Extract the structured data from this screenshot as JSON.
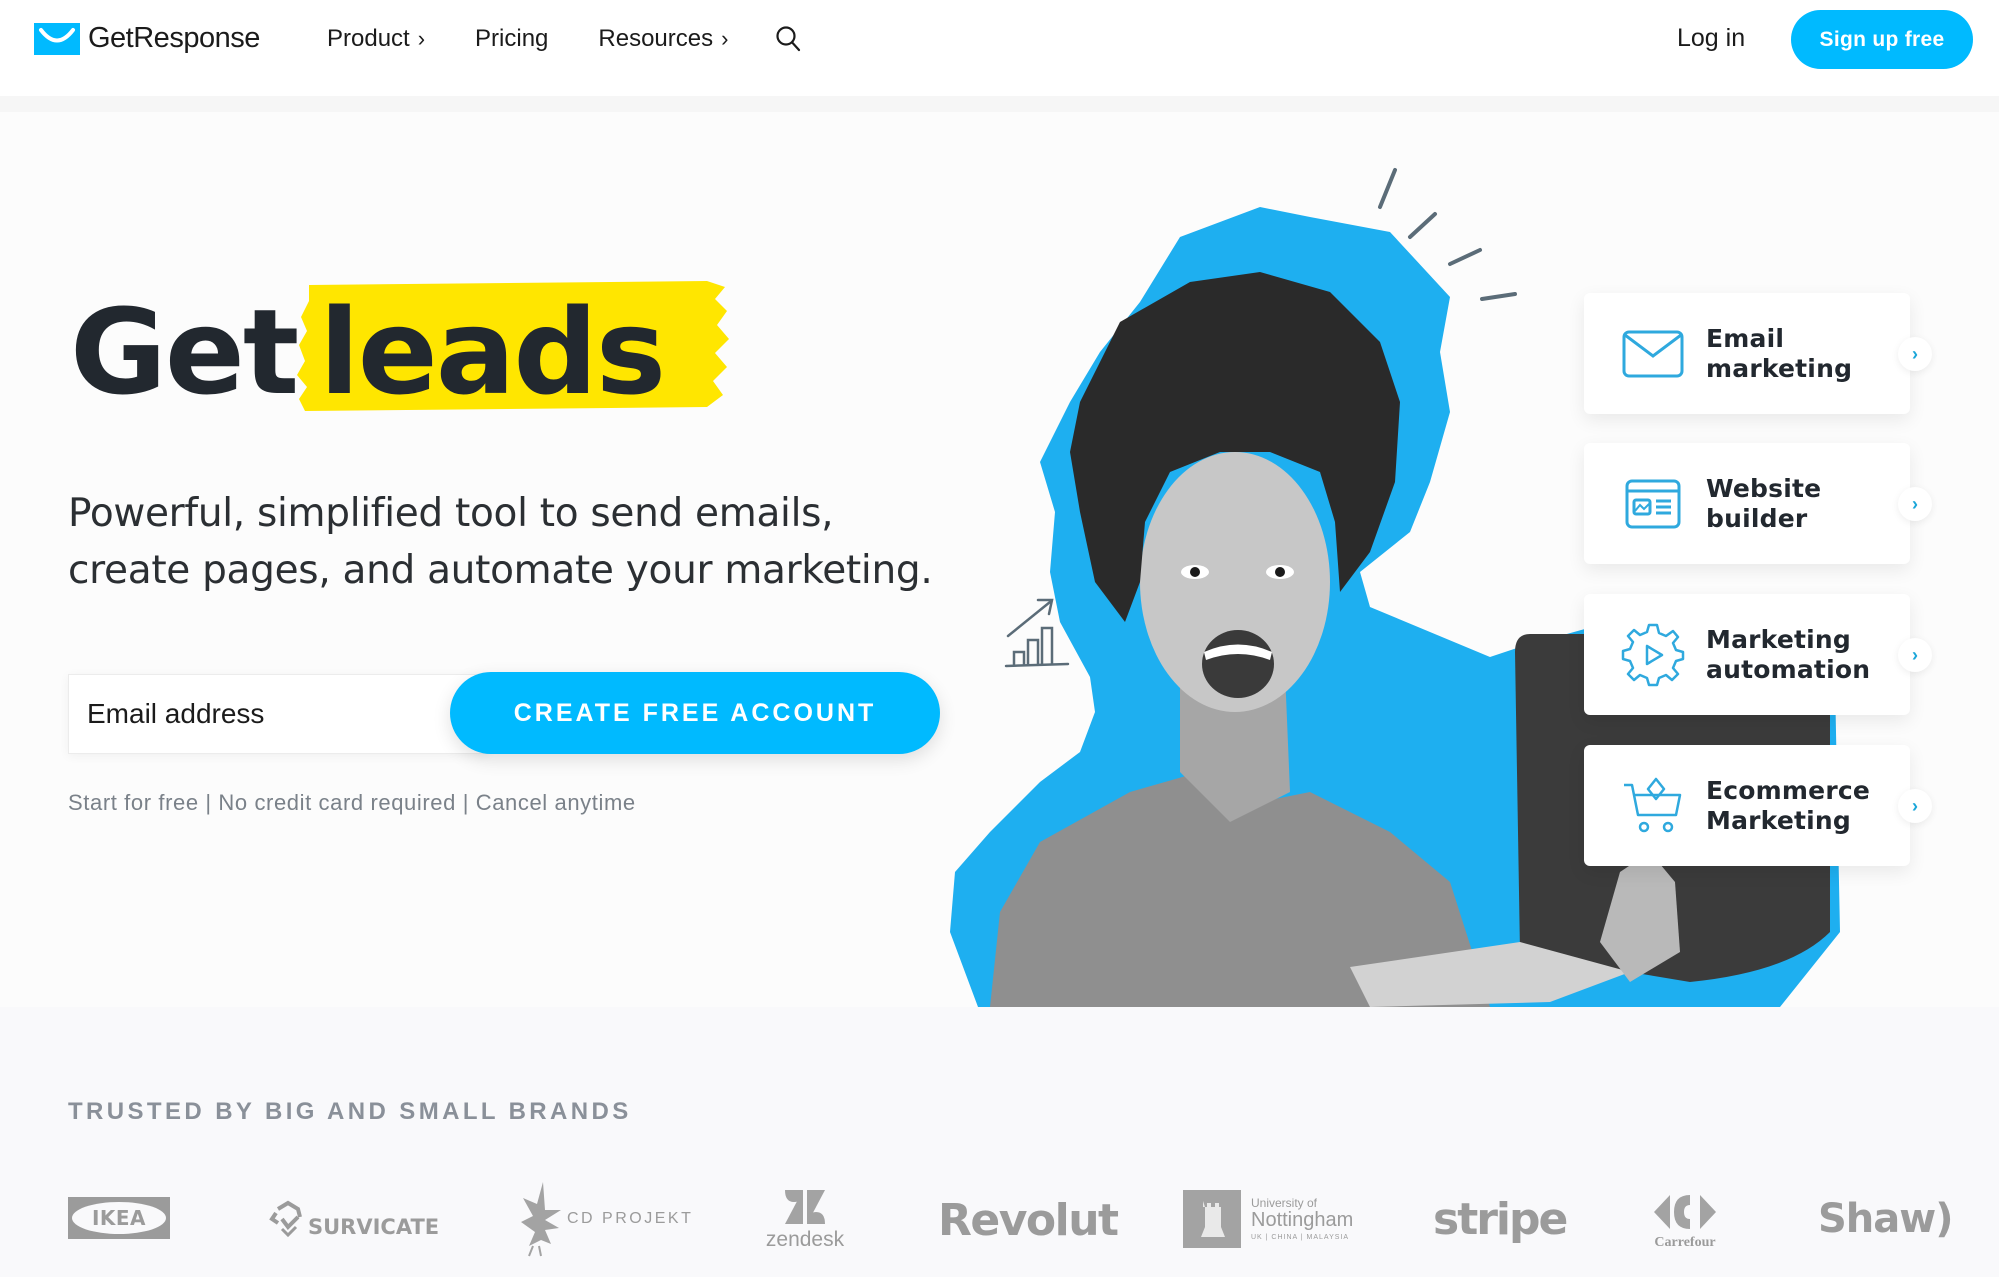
{
  "header": {
    "brand": "GetResponse",
    "nav": [
      {
        "label": "Product",
        "has_submenu": true
      },
      {
        "label": "Pricing",
        "has_submenu": false
      },
      {
        "label": "Resources",
        "has_submenu": true
      }
    ],
    "submenu_chevron": "›",
    "search_icon": "search-icon",
    "login_label": "Log in",
    "signup_label": "Sign up free"
  },
  "hero": {
    "headline_plain": "Get",
    "headline_highlight": "leads",
    "subtitle_line1": "Powerful, simplified tool to send emails,",
    "subtitle_line2": "create pages, and automate your marketing.",
    "email_placeholder": "Email address",
    "email_value": "",
    "cta_label": "CREATE FREE ACCOUNT",
    "fine_print": "Start for free | No credit card required | Cancel anytime"
  },
  "features": [
    {
      "line1": "Email",
      "line2": "marketing",
      "icon": "envelope-icon"
    },
    {
      "line1": "Website",
      "line2": "builder",
      "icon": "website-builder-icon"
    },
    {
      "line1": "Marketing",
      "line2": "automation",
      "icon": "gear-play-icon"
    },
    {
      "line1": "Ecommerce",
      "line2": "Marketing",
      "icon": "shopping-cart-icon"
    }
  ],
  "feature_chevron": "›",
  "trusted": {
    "title": "TRUSTED BY BIG AND SMALL BRANDS",
    "brands": [
      "IKEA",
      "SURVICATE",
      "CD PROJEKT",
      "zendesk",
      "Revolut",
      "University of Nottingham",
      "stripe",
      "Carrefour",
      "Shaw)"
    ],
    "nottingham_line1": "University of",
    "nottingham_line2": "Nottingham",
    "nottingham_line3": "UK | CHINA | MALAYSIA"
  },
  "colors": {
    "brand_blue": "#00baff",
    "highlight_yellow": "#ffe600",
    "text_dark": "#22282f",
    "muted_gray": "#8a9099"
  }
}
